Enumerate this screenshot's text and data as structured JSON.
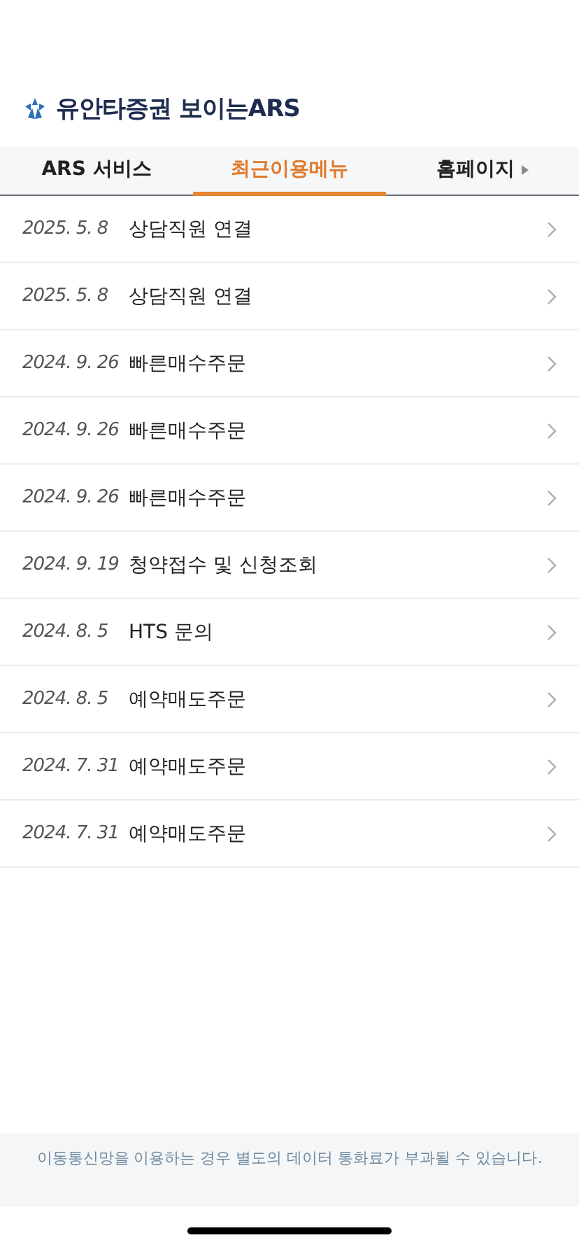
{
  "header": {
    "title": "유안타증권 보이는ARS"
  },
  "tabs": [
    {
      "label": "ARS 서비스",
      "selected": false,
      "kind": "plain"
    },
    {
      "label": "최근이용메뉴",
      "selected": true,
      "kind": "plain"
    },
    {
      "label": "홈페이지",
      "selected": false,
      "kind": "link"
    }
  ],
  "history": [
    {
      "date": "2025. 5. 8",
      "menu": "상담직원 연결"
    },
    {
      "date": "2025. 5. 8",
      "menu": "상담직원 연결"
    },
    {
      "date": "2024. 9. 26",
      "menu": "빠른매수주문"
    },
    {
      "date": "2024. 9. 26",
      "menu": "빠른매수주문"
    },
    {
      "date": "2024. 9. 26",
      "menu": "빠른매수주문"
    },
    {
      "date": "2024. 9. 19",
      "menu": "청약접수 및 신청조회"
    },
    {
      "date": "2024. 8. 5",
      "menu": "HTS 문의"
    },
    {
      "date": "2024. 8. 5",
      "menu": "예약매도주문"
    },
    {
      "date": "2024. 7. 31",
      "menu": "예약매도주문"
    },
    {
      "date": "2024. 7. 31",
      "menu": "예약매도주문"
    }
  ],
  "footer": {
    "notice": "이동통신망을 이용하는 경우 별도의 데이터 통화료가 부과될 수 있습니다."
  }
}
